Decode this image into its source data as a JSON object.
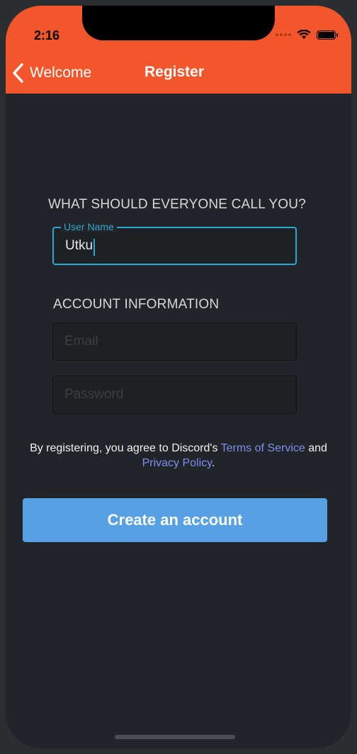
{
  "status_bar": {
    "time": "2:16",
    "icons": [
      "signal-dots-icon",
      "wifi-icon",
      "battery-icon"
    ]
  },
  "nav": {
    "back_label": "Welcome",
    "title": "Register"
  },
  "section_name": {
    "heading": "WHAT SHOULD EVERYONE CALL YOU?",
    "username_label": "User Name",
    "username_value": "Utku"
  },
  "section_account": {
    "heading": "ACCOUNT INFORMATION",
    "email_placeholder": "Email",
    "email_value": "",
    "password_placeholder": "Password",
    "password_value": ""
  },
  "terms": {
    "prefix": "By registering, you agree to Discord's ",
    "terms_link": "Terms of Service",
    "middle": " and ",
    "privacy_link": "Privacy Policy",
    "suffix": "."
  },
  "actions": {
    "create_label": "Create an account"
  },
  "colors": {
    "header": "#f4562b",
    "background": "#212428",
    "accent": "#2fa8d0",
    "button": "#57a0e4",
    "link": "#7c8ff0"
  }
}
